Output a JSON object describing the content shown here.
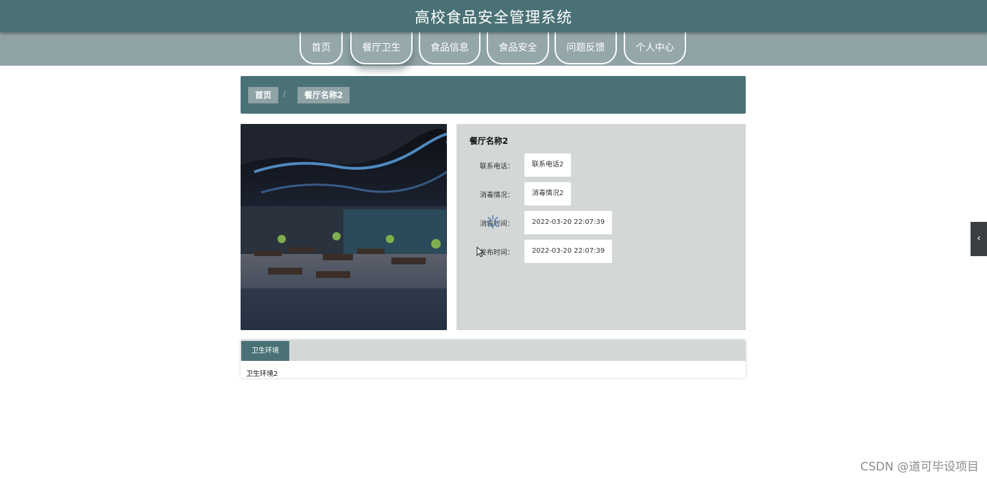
{
  "app": {
    "title": "高校食品安全管理系统"
  },
  "nav": {
    "items": [
      "首页",
      "餐厅卫生",
      "食品信息",
      "食品安全",
      "问题反馈",
      "个人中心"
    ],
    "active": "餐厅卫生"
  },
  "breadcrumb": {
    "home": "首页",
    "separator": "/",
    "current": "餐厅名称2"
  },
  "restaurant": {
    "name": "餐厅名称2",
    "fields": [
      {
        "label": "联系电话：",
        "value": "联系电话2"
      },
      {
        "label": "消毒情况：",
        "value": "消毒情况2"
      },
      {
        "label": "消毒时间：",
        "value": "2022-03-20 22:07:39"
      },
      {
        "label": "发布时间：",
        "value": "2022-03-20 22:07:39"
      }
    ]
  },
  "tabs": {
    "active_label": "卫生环境",
    "content": "卫生环境2"
  },
  "side_toggle": {
    "icon": "chevron-left-icon",
    "glyph": "‹"
  },
  "watermark": "CSDN @道可毕设项目",
  "colors": {
    "primary": "#4a7276",
    "nav_band": "#8fa2a6",
    "panel": "#d3d8d7"
  }
}
